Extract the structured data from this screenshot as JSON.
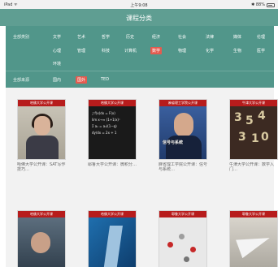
{
  "status_bar": {
    "carrier": "iPad ᯤ",
    "time": "上午9:08",
    "battery_text": "✱ 88%"
  },
  "nav": {
    "title": "课程分类"
  },
  "filters": {
    "row1_label": "全部类别",
    "row1": [
      "文学",
      "艺术",
      "哲学",
      "历史",
      "经济",
      "社会",
      "法律",
      "媒体",
      "伦理"
    ],
    "row2": [
      "心理",
      "管理",
      "科技",
      "计算机",
      "数学",
      "物理",
      "化学",
      "生物",
      "医学"
    ],
    "row3": [
      "环境"
    ],
    "row4_label": "全部来源",
    "row4": [
      "国内",
      "国外",
      "TED"
    ],
    "active_category": "数学",
    "active_source": "国外"
  },
  "courses": [
    {
      "banner": "哈佛大学公开课",
      "cover_title": "",
      "desc": "哈佛大学公开课：SAT写作技巧…"
    },
    {
      "banner": "哈佛大学公开课",
      "cover_title": "",
      "desc": "耶鲁大学公开课：微积分…"
    },
    {
      "banner": "麻省理工学院公开课",
      "cover_title": "信号与系统",
      "desc": "麻省理工学院公开课：信号与系统…"
    },
    {
      "banner": "牛津大学公开课",
      "cover_title": "",
      "desc": "牛津大学公开课：数学入门…"
    },
    {
      "banner": "哈佛大学公开课",
      "cover_title": "",
      "desc": ""
    },
    {
      "banner": "哈佛大学公开课",
      "cover_title": "",
      "desc": ""
    },
    {
      "banner": "耶鲁大学公开课",
      "cover_title": "",
      "desc": ""
    },
    {
      "banner": "耶鲁大学公开课",
      "cover_title": "",
      "desc": ""
    }
  ],
  "colors": {
    "nav": "#5f9e92",
    "panel": "#51968a",
    "active_chip": "#e45b4f",
    "banner": "#b71c1c"
  }
}
